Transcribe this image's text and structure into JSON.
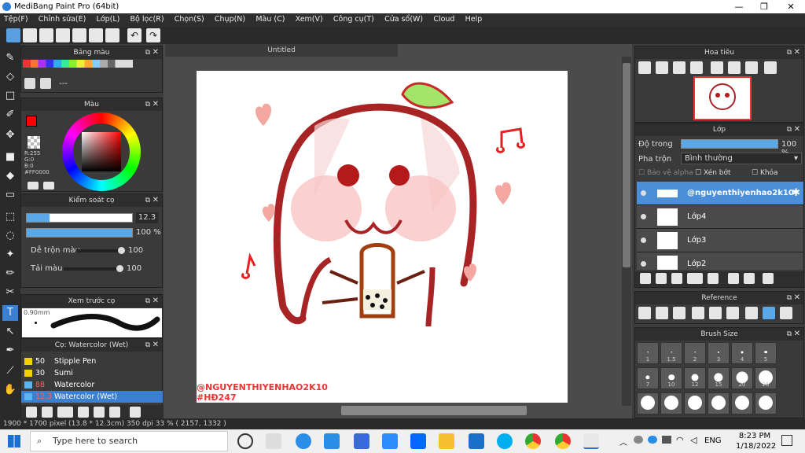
{
  "window": {
    "title": "MediBang Paint Pro (64bit)"
  },
  "menu": [
    "Tệp(F)",
    "Chỉnh sửa(E)",
    "Lớp(L)",
    "Bộ lọc(R)",
    "Chọn(S)",
    "Chụp(N)",
    "Màu (C)",
    "Xem(V)",
    "Công cụ(T)",
    "Cửa sổ(W)",
    "Cloud",
    "Help"
  ],
  "panels": {
    "palette": "Bảng màu",
    "palette_text": "---",
    "color": "Màu",
    "control": "Kiểm soát cọ",
    "preview": "Xem trước cọ",
    "brush": "Cọ: Watercolor (Wet)",
    "navigator": "Hoa tiêu",
    "layers": "Lớp",
    "reference": "Reference",
    "brush_size": "Brush Size"
  },
  "color": {
    "r": "R:255",
    "g": "G:0",
    "b": "B:0",
    "hex": "#FF0000",
    "primary": "#FF0000"
  },
  "control": {
    "size": "12.3",
    "opacity": "100 %",
    "blend_label": "Dễ trộn màu",
    "blend_val": "100",
    "refill_label": "Tải màu",
    "refill_val": "100"
  },
  "preview": {
    "size": "0.90mm"
  },
  "brushes": [
    {
      "size": "50",
      "name": "Stipple Pen",
      "color": "#f3d200"
    },
    {
      "size": "30",
      "name": "Sumi",
      "color": "#f3d200"
    },
    {
      "size": "88",
      "name": "Watercolor",
      "color": "#5ab4f0",
      "size_color": "#ff6060"
    },
    {
      "size": "12.3",
      "name": "Watercolor (Wet)",
      "color": "#5ab4f0",
      "size_color": "#ff6060"
    }
  ],
  "document": {
    "tab": "Untitled"
  },
  "watermark": {
    "line1": "@NGUYENTHIYENHAO2K10",
    "line2": "#HĐ247"
  },
  "layers_panel": {
    "opacity_label": "Độ trong",
    "opacity_val": "100 %",
    "opacity_fraction": 1.0,
    "blend_label": "Pha trộn",
    "blend_val": "Bình thường",
    "alpha_label": "Bảo vệ alpha",
    "clip_label": "Xén bớt",
    "lock_label": "Khóa",
    "items": [
      "@nguyenthiyenhao2k10",
      "Lớp4",
      "Lớp3",
      "Lớp2"
    ]
  },
  "brush_sizes": [
    "1",
    "1.5",
    "2",
    "3",
    "4",
    "5",
    "7",
    "10",
    "12",
    "15",
    "20",
    "25"
  ],
  "status": "1900 * 1700 pixel  (13.8 * 12.3cm)  350 dpi  33 %  ( 2157, 1332 )",
  "taskbar": {
    "search": "Type here to search",
    "lang": "ENG",
    "time": "8:23 PM",
    "date": "1/18/2022"
  }
}
